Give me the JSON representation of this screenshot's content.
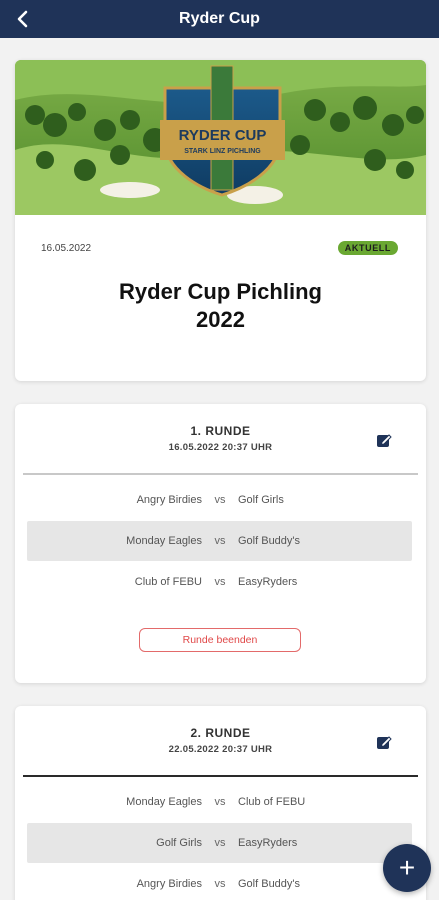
{
  "header": {
    "title": "Ryder Cup"
  },
  "event": {
    "date": "16.05.2022",
    "badge": "AKTUELL",
    "title_line1": "Ryder Cup Pichling",
    "title_line2": "2022",
    "logo_line1": "RYDER CUP",
    "logo_line2": "STARK LINZ PICHLING",
    "badge_color": "#6aa832"
  },
  "rounds": [
    {
      "name": "1. RUNDE",
      "datetime": "16.05.2022 20:37 UHR",
      "matches": [
        {
          "home": "Angry Birdies",
          "vs": "vs",
          "away": "Golf Girls"
        },
        {
          "home": "Monday Eagles",
          "vs": "vs",
          "away": "Golf Buddy's"
        },
        {
          "home": "Club of FEBU",
          "vs": "vs",
          "away": "EasyRyders"
        }
      ],
      "end_button": "Runde beenden"
    },
    {
      "name": "2. RUNDE",
      "datetime": "22.05.2022 20:37 UHR",
      "matches": [
        {
          "home": "Monday Eagles",
          "vs": "vs",
          "away": "Club of FEBU"
        },
        {
          "home": "Golf Girls",
          "vs": "vs",
          "away": "EasyRyders"
        },
        {
          "home": "Angry Birdies",
          "vs": "vs",
          "away": "Golf Buddy's"
        }
      ]
    }
  ],
  "fab": {
    "label": "+"
  },
  "colors": {
    "primary": "#1f3358",
    "danger": "#e04848",
    "accent": "#6aa832"
  }
}
